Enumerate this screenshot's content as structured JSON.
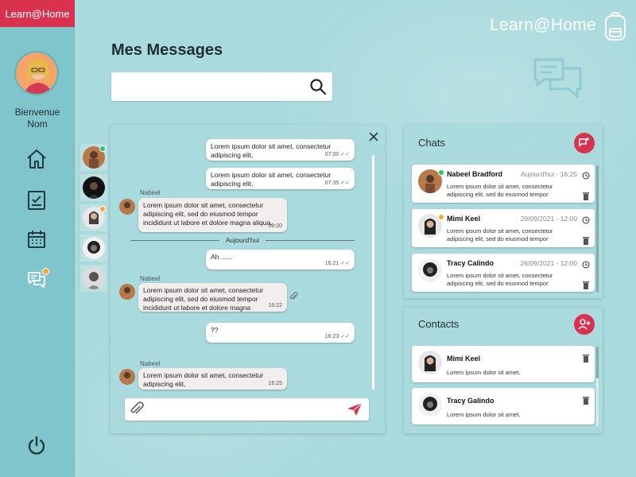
{
  "brand": {
    "tag": "Learn@Home",
    "header": "Learn@Home"
  },
  "user": {
    "welcome": "Bienvenue",
    "name": "Nom"
  },
  "page": {
    "title": "Mes Messages"
  },
  "search": {
    "placeholder": ""
  },
  "colors": {
    "accent": "#d9324f",
    "online": "#27c26a",
    "away": "#f4a637"
  },
  "nav": [
    {
      "icon": "home-icon"
    },
    {
      "icon": "checklist-icon"
    },
    {
      "icon": "calendar-icon"
    },
    {
      "icon": "messages-icon",
      "badge": true
    }
  ],
  "conversation": {
    "day_separator": "Aujourd'hui",
    "messages": [
      {
        "dir": "out",
        "text": "Lorem ipsum dolor sit amet, consectetur adipiscing elit,",
        "time": "07:00"
      },
      {
        "dir": "out",
        "text": "Lorem ipsum dolor sit amet, consectetur adipiscing elit,",
        "time": "07:35"
      },
      {
        "dir": "in",
        "sender": "Nabeel",
        "text": "Lorem ipsum dolor sit amet, consectetur adipiscing elit, sed do eiusmod tempor incididunt ut labore et dolore magna aliqua.",
        "time": "08:00"
      },
      {
        "dir": "out",
        "text": "Ah ......",
        "time": "16:21"
      },
      {
        "dir": "in",
        "sender": "Nabeel",
        "text": "Lorem ipsum dolor sit amet, consectetur adipiscing elit, sed do eiusmod tempor incididunt ut labore et dolore magna",
        "time": "16:22"
      },
      {
        "dir": "out",
        "text": "??",
        "time": "16:23"
      },
      {
        "dir": "in",
        "sender": "Nabeel",
        "text": "Lorem ipsum dolor sit amet, consectetur adipiscing elit,",
        "time": "16:25"
      }
    ],
    "compose_placeholder": ""
  },
  "chats": {
    "title": "Chats",
    "items": [
      {
        "name": "Nabeel Bradford",
        "date": "Aujourd'hui - 16:25",
        "preview": "Lorem ipsum dolor sit amet, consectetur adipiscing elit, sed do eiusmod tempor",
        "status": "online"
      },
      {
        "name": "Mimi Keel",
        "date": "29/09/2021 - 12:00",
        "preview": "Lorem ipsum dolor sit amet, consectetur adipiscing elit, sed do eiusmod tempor",
        "status": "away"
      },
      {
        "name": "Tracy Calindo",
        "date": "26/09/2021 - 12:00",
        "preview": "Lorem ipsum dolor sit amet, consectetur adipiscing elit, sed do eiusmod tempor",
        "status": ""
      }
    ]
  },
  "contacts": {
    "title": "Contacts",
    "items": [
      {
        "name": "Mimi Keel",
        "preview": "Lorem ipsum dolor sit amet."
      },
      {
        "name": "Tracy Galindo",
        "preview": "Lorem ipsum dolor sit amet."
      }
    ]
  }
}
